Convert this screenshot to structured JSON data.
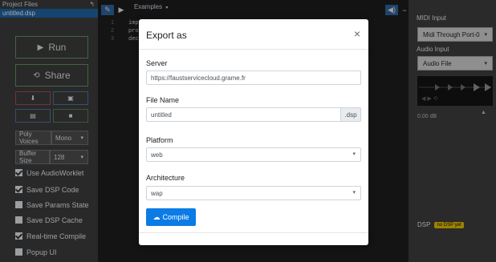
{
  "left": {
    "header_label": "Project Files",
    "file_name": "untitled.dsp",
    "run_label": "Run",
    "share_label": "Share",
    "poly_voices_label": "Poly Voices",
    "poly_voices_value": "Mono",
    "buffer_size_label": "Buffer Size",
    "buffer_size_value": "128",
    "options": [
      {
        "label": "Use AudioWorklet",
        "checked": true
      },
      {
        "label": "Save DSP Code",
        "checked": true
      },
      {
        "label": "Save Params State",
        "checked": false
      },
      {
        "label": "Save DSP Cache",
        "checked": false
      },
      {
        "label": "Real-time Compile",
        "checked": true
      },
      {
        "label": "Popup UI",
        "checked": false
      }
    ]
  },
  "toolbar": {
    "examples_label": "Examples"
  },
  "editor": {
    "gutter": [
      "1",
      "2",
      "3"
    ],
    "code_lines": [
      "imp",
      "pro",
      "dec"
    ]
  },
  "right": {
    "midi_input_label": "MIDI Input",
    "midi_input_value": "Midi Through Port-0",
    "audio_input_label": "Audio Input",
    "audio_input_value": "Audio File",
    "db_value": "0.00 dB",
    "dsp_label": "DSP",
    "dsp_badge": "no DSP yet"
  },
  "modal": {
    "title": "Export as",
    "close_symbol": "×",
    "server_label": "Server",
    "server_value": "https://faustservicecloud.grame.fr",
    "file_name_label": "File Name",
    "file_name_value": "untitled",
    "file_suffix": ".dsp",
    "platform_label": "Platform",
    "platform_value": "web",
    "architecture_label": "Architecture",
    "architecture_value": "wap",
    "compile_label": "Compile"
  },
  "colors": {
    "accent_blue": "#0b7be6",
    "selected_file_blue": "#1e5f9c",
    "dsp_badge_yellow": "#d9b500"
  }
}
